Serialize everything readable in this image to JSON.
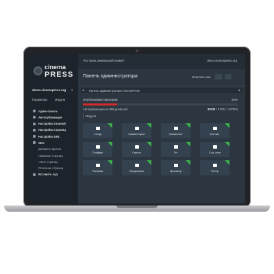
{
  "sidebar": {
    "logo_line1": "cinema",
    "logo_line2": "PRESS",
    "site": "demo.cinemapress.org",
    "tabs": [
      "Параметры",
      "Модули"
    ],
    "menu": [
      {
        "label": "Админ-панель",
        "kind": "active"
      },
      {
        "label": "Автопубликация",
        "kind": "bold"
      },
      {
        "label": "Настройка главной",
        "kind": "bold"
      },
      {
        "label": "Настройка страниц",
        "kind": "bold"
      },
      {
        "label": "Настройка URL",
        "kind": "bold"
      },
      {
        "label": "SEO",
        "kind": "bold"
      },
      {
        "label": "Добавить фильм",
        "kind": "sub"
      },
      {
        "label": "Название страниц",
        "kind": "sub"
      },
      {
        "label": "«404» страниц",
        "kind": "sub"
      },
      {
        "label": "Описание страниц",
        "kind": "sub"
      },
      {
        "label": "Вставить код",
        "kind": "bold"
      }
    ]
  },
  "topbar": {
    "question": "Что такое уникальный пламя?",
    "domain": "demo.cinemapress.org"
  },
  "header": {
    "title": "Панель администратора",
    "clear_cache": "Очистить кэш"
  },
  "breadcrumb": "Панель администратора CinemaPress",
  "progress": {
    "label": "Опубликовано фильмов",
    "percent_text": "22%",
    "value": 0.22
  },
  "autopub": {
    "label": "Автопубликация на 899 дней(-ей)",
    "count": "30133",
    "rest": "/ 97224 / 137904"
  },
  "modules_label": "Модули",
  "tiles": [
    "Склад",
    "Комментарии",
    "Связанные",
    "Контакт",
    "Слайдер",
    "Скрыть",
    "Тег",
    "Соц. сети",
    "Рекламы",
    "Продолжить",
    "Просмотр",
    "Плеер"
  ],
  "colors": {
    "accent_red": "#d72b2b",
    "accent_green": "#3db14c",
    "panel_bg": "#2b3640",
    "sidebar_bg": "#1c232a"
  }
}
